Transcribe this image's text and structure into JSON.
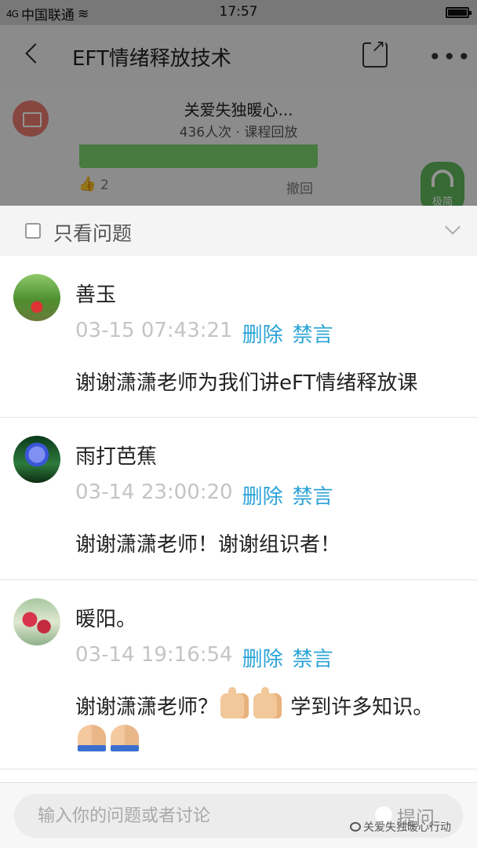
{
  "status_bar": {
    "signal": "4G",
    "carrier": "中国联通",
    "time": "17:57"
  },
  "nav": {
    "title": "EFT情绪释放技术"
  },
  "course": {
    "name": "关爱失独暖心...",
    "meta": "436人次 · 课程回放",
    "like_count": "2",
    "withdraw_label": "撤回",
    "listen_label": "极简"
  },
  "filter": {
    "label": "只看问题",
    "checked": false
  },
  "messages": [
    {
      "name": "善玉",
      "time": "03-15 07:43:21",
      "delete_label": "删除",
      "mute_label": "禁言",
      "text": "谢谢潇潇老师为我们讲eFT情绪释放课"
    },
    {
      "name": "雨打芭蕉",
      "time": "03-14 23:00:20",
      "delete_label": "删除",
      "mute_label": "禁言",
      "text": "谢谢潇潇老师！谢谢组识者！"
    },
    {
      "name": "暖阳。",
      "time": "03-14 19:16:54",
      "delete_label": "删除",
      "mute_label": "禁言",
      "text_part1": "谢谢潇潇老师？",
      "text_part2": "学到许多知识。",
      "emojis_line1": [
        "thumbs-up-icon",
        "thumbs-up-icon"
      ],
      "emojis_line2": [
        "folded-hands-icon",
        "folded-hands-icon"
      ]
    }
  ],
  "composer": {
    "placeholder": "输入你的问题或者讨论",
    "ask_label": "提问"
  },
  "watermark": "关爱失独暖心行动",
  "colors": {
    "action_blue": "#2ba3d6",
    "time_gray": "#c4c4c4",
    "listen_green": "#60b75a"
  }
}
